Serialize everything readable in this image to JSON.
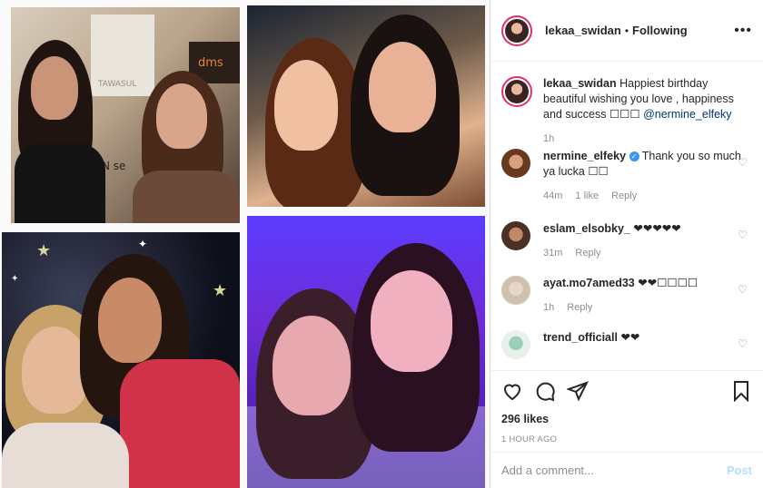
{
  "post": {
    "sign_text_top": "TAWASUL",
    "sign_text_right": "dms",
    "sign_text_mid": "N se"
  },
  "header": {
    "username": "lekaa_swidan",
    "separator": "•",
    "follow_status": "Following",
    "more_label": "•••"
  },
  "caption": {
    "username": "lekaa_swidan",
    "text": "Happiest birthday beautiful wishing you love , happiness and success",
    "emoji": "☐☐☐",
    "mention": "@nermine_elfeky",
    "time": "1h"
  },
  "comments": [
    {
      "username": "nermine_elfeky",
      "verified": "✓",
      "text": "Thank you so much ya lucka ☐☐",
      "time": "44m",
      "likes": "1 like",
      "reply": "Reply"
    },
    {
      "username": "eslam_elsobky_",
      "text": "❤❤❤❤❤",
      "time": "31m",
      "reply": "Reply"
    },
    {
      "username": "ayat.mo7amed33",
      "text": "❤❤☐☐☐☐",
      "time": "1h",
      "reply": "Reply"
    },
    {
      "username": "trend_officiall",
      "text": "❤❤"
    }
  ],
  "actions": {
    "likes": "296 likes",
    "posted": "1 HOUR AGO"
  },
  "add_comment": {
    "placeholder": "Add a comment...",
    "post_label": "Post"
  }
}
